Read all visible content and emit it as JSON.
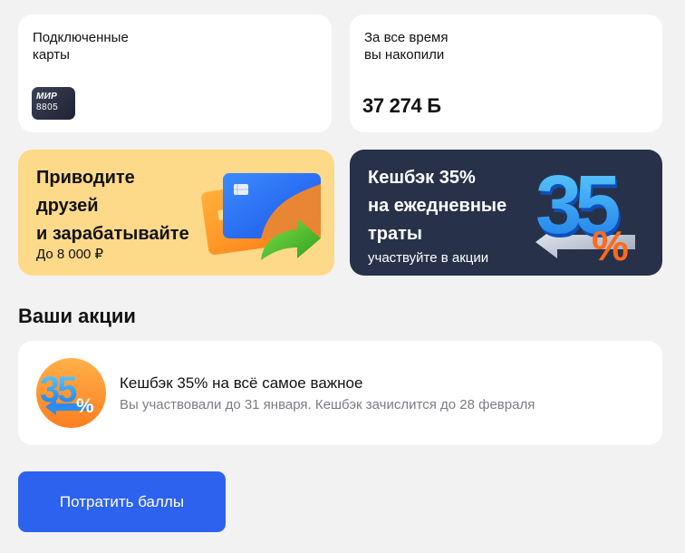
{
  "connected_cards": {
    "title": "Подключенные\nкарты",
    "card": {
      "brand": "МИР",
      "last_digits": "8805"
    }
  },
  "accumulated": {
    "title": "За все время\nвы накопили",
    "value": "37 274 Б"
  },
  "promos": [
    {
      "title": "Приводите\nдрузей\nи зарабатывайте",
      "subtitle": "До 8 000 ₽",
      "background": "#fdd98a",
      "art": "bank-cards-with-green-arrow"
    },
    {
      "title": "Кешбэк 35%\nна ежедневные\nтраты",
      "subtitle": "участвуйте в акции",
      "background": "#27324a",
      "art": "blue-35-percent-with-arrow"
    }
  ],
  "actions_section": {
    "title": "Ваши акции",
    "items": [
      {
        "title": "Кешбэк 35% на всё самое важное",
        "description": "Вы участвовали до 31 января. Кешбэк зачислится до 28 февраля",
        "icon": "cashback-35-icon"
      }
    ]
  },
  "spend_button": {
    "label": "Потратить баллы",
    "color": "#2d62ef"
  }
}
